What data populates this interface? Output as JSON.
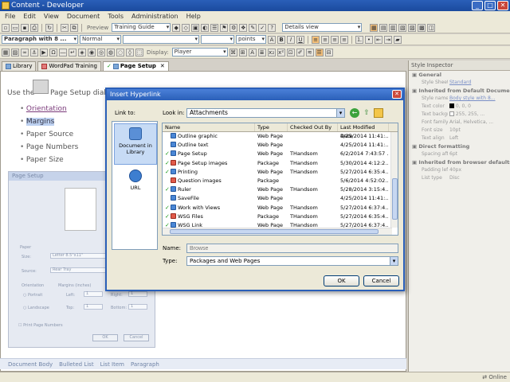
{
  "window": {
    "title": "Content - Developer"
  },
  "menu": [
    "File",
    "Edit",
    "View",
    "Document",
    "Tools",
    "Administration",
    "Help"
  ],
  "toolbar1": {
    "preview": "Preview",
    "guide": "Training Guide",
    "view": "Details view"
  },
  "toolbar2": {
    "paragraph": "Paragraph with 8 ...",
    "style": "Normal",
    "units": "points"
  },
  "toolbar3": {
    "display_label": "Display:",
    "display_value": "Player"
  },
  "tabs": [
    {
      "label": "Library"
    },
    {
      "label": "WordPad Training"
    },
    {
      "label": "Page Setup"
    }
  ],
  "editor": {
    "intro": "Use the",
    "intro_tail": "Page Setup dialog",
    "bullets": [
      "Orientation",
      "Margins",
      "Paper Source",
      "Page Numbers",
      "Paper Size"
    ]
  },
  "page_setup_preview": {
    "title": "Page Setup",
    "paper": "Paper",
    "size_label": "Size:",
    "size_value": "Letter 8.5\"x11\"",
    "source_label": "Source:",
    "source_value": "Rear Tray",
    "orientation": "Orientation",
    "portrait": "Portrait",
    "landscape": "Landscape",
    "margins": "Margins (inches)",
    "left": "Left:",
    "right": "Right:",
    "top": "Top:",
    "bottom": "Bottom:",
    "margin_val": "1",
    "print_page_numbers": "Print Page Numbers",
    "ok": "OK",
    "cancel": "Cancel"
  },
  "styles_bar": [
    "Document Body",
    "Bulleted List",
    "List Item",
    "Paragraph"
  ],
  "inspector": {
    "title": "Style Inspector",
    "general": "General",
    "stylesheet_k": "Style Sheet",
    "stylesheet_v": "Standard",
    "inherited_doc": "Inherited from Default Document",
    "rows": [
      {
        "k": "Style name",
        "v": "Body style with 8..."
      },
      {
        "k": "Text color",
        "v": "0, 0, 0"
      },
      {
        "k": "Text background",
        "v": "255, 255, ..."
      },
      {
        "k": "Font family",
        "v": "Arial, Helvetica, ..."
      },
      {
        "k": "Font size",
        "v": "10pt"
      },
      {
        "k": "Text align",
        "v": "Left"
      }
    ],
    "direct": "Direct formatting",
    "spacing_k": "Spacing after",
    "spacing_v": "6pt",
    "inherited_browser": "Inherited from browser defaults",
    "rows2": [
      {
        "k": "Padding left",
        "v": "40px"
      },
      {
        "k": "List type",
        "v": "Disc"
      }
    ]
  },
  "status": {
    "online": "Online"
  },
  "dialog": {
    "title": "Insert Hyperlink",
    "link_to": "Link to:",
    "link_items": [
      "Document in Library",
      "URL"
    ],
    "look_in_label": "Look in:",
    "look_in_value": "Attachments",
    "columns": [
      "Name",
      "Type",
      "Checked Out By",
      "Last Modified Date"
    ],
    "files": [
      {
        "name": "Outline graphic",
        "type": "Web Page",
        "by": "",
        "date": "4/25/2014 11:41:...",
        "check": false,
        "icon": "web"
      },
      {
        "name": "Outline text",
        "type": "Web Page",
        "by": "",
        "date": "4/25/2014 11:41:...",
        "check": false,
        "icon": "web"
      },
      {
        "name": "Page Setup",
        "type": "Web Page",
        "by": "THandsom",
        "date": "6/2/2014 7:43:57 ...",
        "check": true,
        "icon": "web"
      },
      {
        "name": "Page Setup images",
        "type": "Package",
        "by": "THandsom",
        "date": "5/30/2014 4:12:2...",
        "check": true,
        "icon": "pkg"
      },
      {
        "name": "Printing",
        "type": "Web Page",
        "by": "THandsom",
        "date": "5/27/2014 6:35:4...",
        "check": true,
        "icon": "web"
      },
      {
        "name": "Question images",
        "type": "Package",
        "by": "",
        "date": "5/6/2014 4:52:02...",
        "check": false,
        "icon": "pkg"
      },
      {
        "name": "Ruler",
        "type": "Web Page",
        "by": "THandsom",
        "date": "5/28/2014 3:15:4...",
        "check": true,
        "icon": "web"
      },
      {
        "name": "SaveFile",
        "type": "Web Page",
        "by": "",
        "date": "4/25/2014 11:41:...",
        "check": false,
        "icon": "web"
      },
      {
        "name": "Work with Views",
        "type": "Web Page",
        "by": "THandsom",
        "date": "5/27/2014 6:37:4...",
        "check": true,
        "icon": "web"
      },
      {
        "name": "WSG Files",
        "type": "Package",
        "by": "THandsom",
        "date": "5/27/2014 6:35:4...",
        "check": true,
        "icon": "pkg"
      },
      {
        "name": "WSG Link",
        "type": "Web Page",
        "by": "THandsom",
        "date": "5/27/2014 6:37:4...",
        "check": true,
        "icon": "web"
      }
    ],
    "name_label": "Name:",
    "name_placeholder": "Browse",
    "type_label": "Type:",
    "type_value": "Packages and Web Pages",
    "ok": "OK",
    "cancel": "Cancel"
  }
}
